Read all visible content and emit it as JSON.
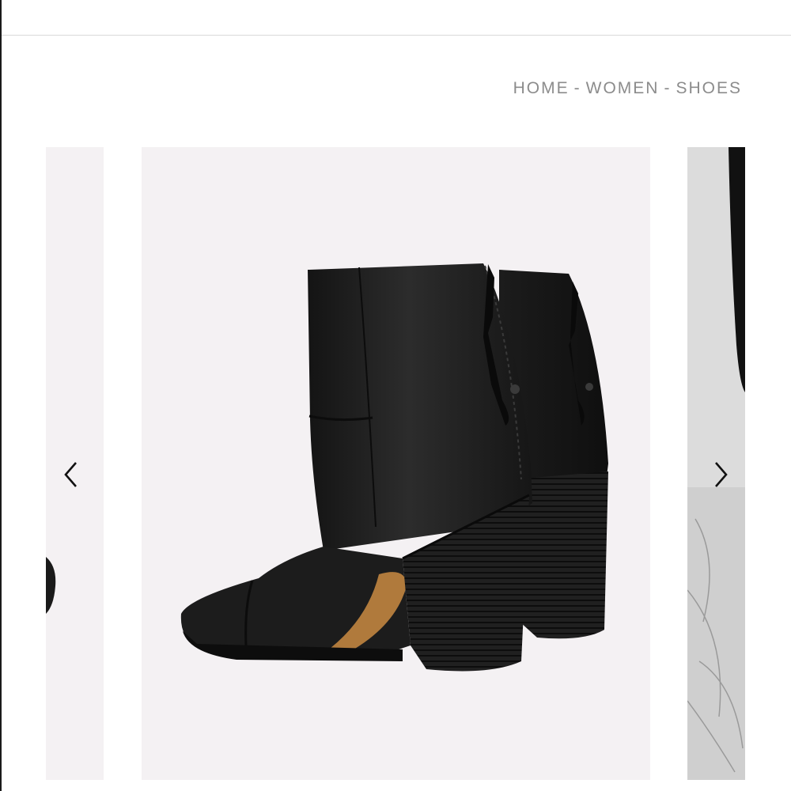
{
  "breadcrumb": {
    "home": "HOME",
    "women": "WOMEN",
    "shoes": "SHOES",
    "separator": "-"
  },
  "carousel": {
    "prev_icon": "chevron-left-icon",
    "next_icon": "chevron-right-icon"
  },
  "colors": {
    "slide_background": "#f4f1f3",
    "breadcrumb_text": "#8c8c8c",
    "boot_leather": "#1e1e1e",
    "sole_tan": "#b07a3c"
  }
}
